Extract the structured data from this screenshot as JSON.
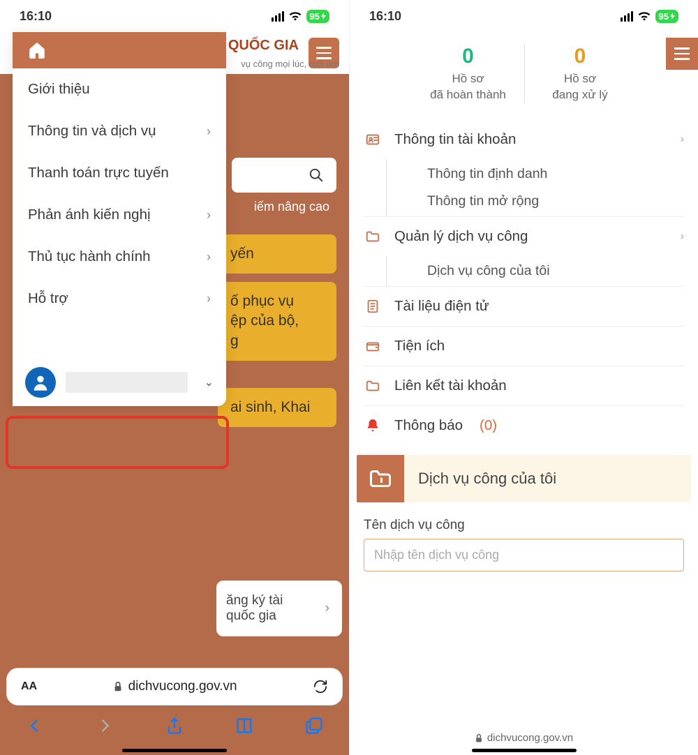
{
  "statusbar": {
    "time": "16:10",
    "battery": "95"
  },
  "left": {
    "header_title": "G QUỐC GIA",
    "header_sub": "vụ công mọi lúc, mọi nơi",
    "adv_search": "iếm nâng cao",
    "gold1": "yến",
    "gold2": "ố phục vụ\nệp của bộ,\ng",
    "gold3": "ai sinh, Khai",
    "panel": "ăng ký tài\nquốc gia",
    "drawer": {
      "items": [
        {
          "label": "Giới thiệu",
          "chev": false
        },
        {
          "label": "Thông tin và dịch vụ",
          "chev": true
        },
        {
          "label": "Thanh toán trực tuyến",
          "chev": false
        },
        {
          "label": "Phản ánh kiến nghị",
          "chev": true
        },
        {
          "label": "Thủ tục hành chính",
          "chev": true
        },
        {
          "label": "Hỗ trợ",
          "chev": true
        }
      ]
    },
    "safari_url": "dichvucong.gov.vn",
    "font_btn": "AA"
  },
  "right": {
    "stats": {
      "done": {
        "num": "0",
        "l1": "Hồ sơ",
        "l2": "đã hoàn thành"
      },
      "proc": {
        "num": "0",
        "l1": "Hồ sơ",
        "l2": "đang xử lý"
      }
    },
    "menu": {
      "account": "Thông tin tài khoản",
      "account_subs": [
        "Thông tin định danh",
        "Thông tin mở rộng"
      ],
      "services": "Quản lý dịch vụ công",
      "services_subs": [
        "Dịch vụ công của tôi"
      ],
      "docs": "Tài liệu điện tử",
      "util": "Tiện ích",
      "link": "Liên kết tài khoản",
      "notif": "Thông báo",
      "notif_count": "(0)"
    },
    "banner_title": "Dịch vụ công của tôi",
    "search_label": "Tên dịch vụ công",
    "search_placeholder": "Nhập tên dịch vụ công",
    "mini_url": "dichvucong.gov.vn"
  }
}
